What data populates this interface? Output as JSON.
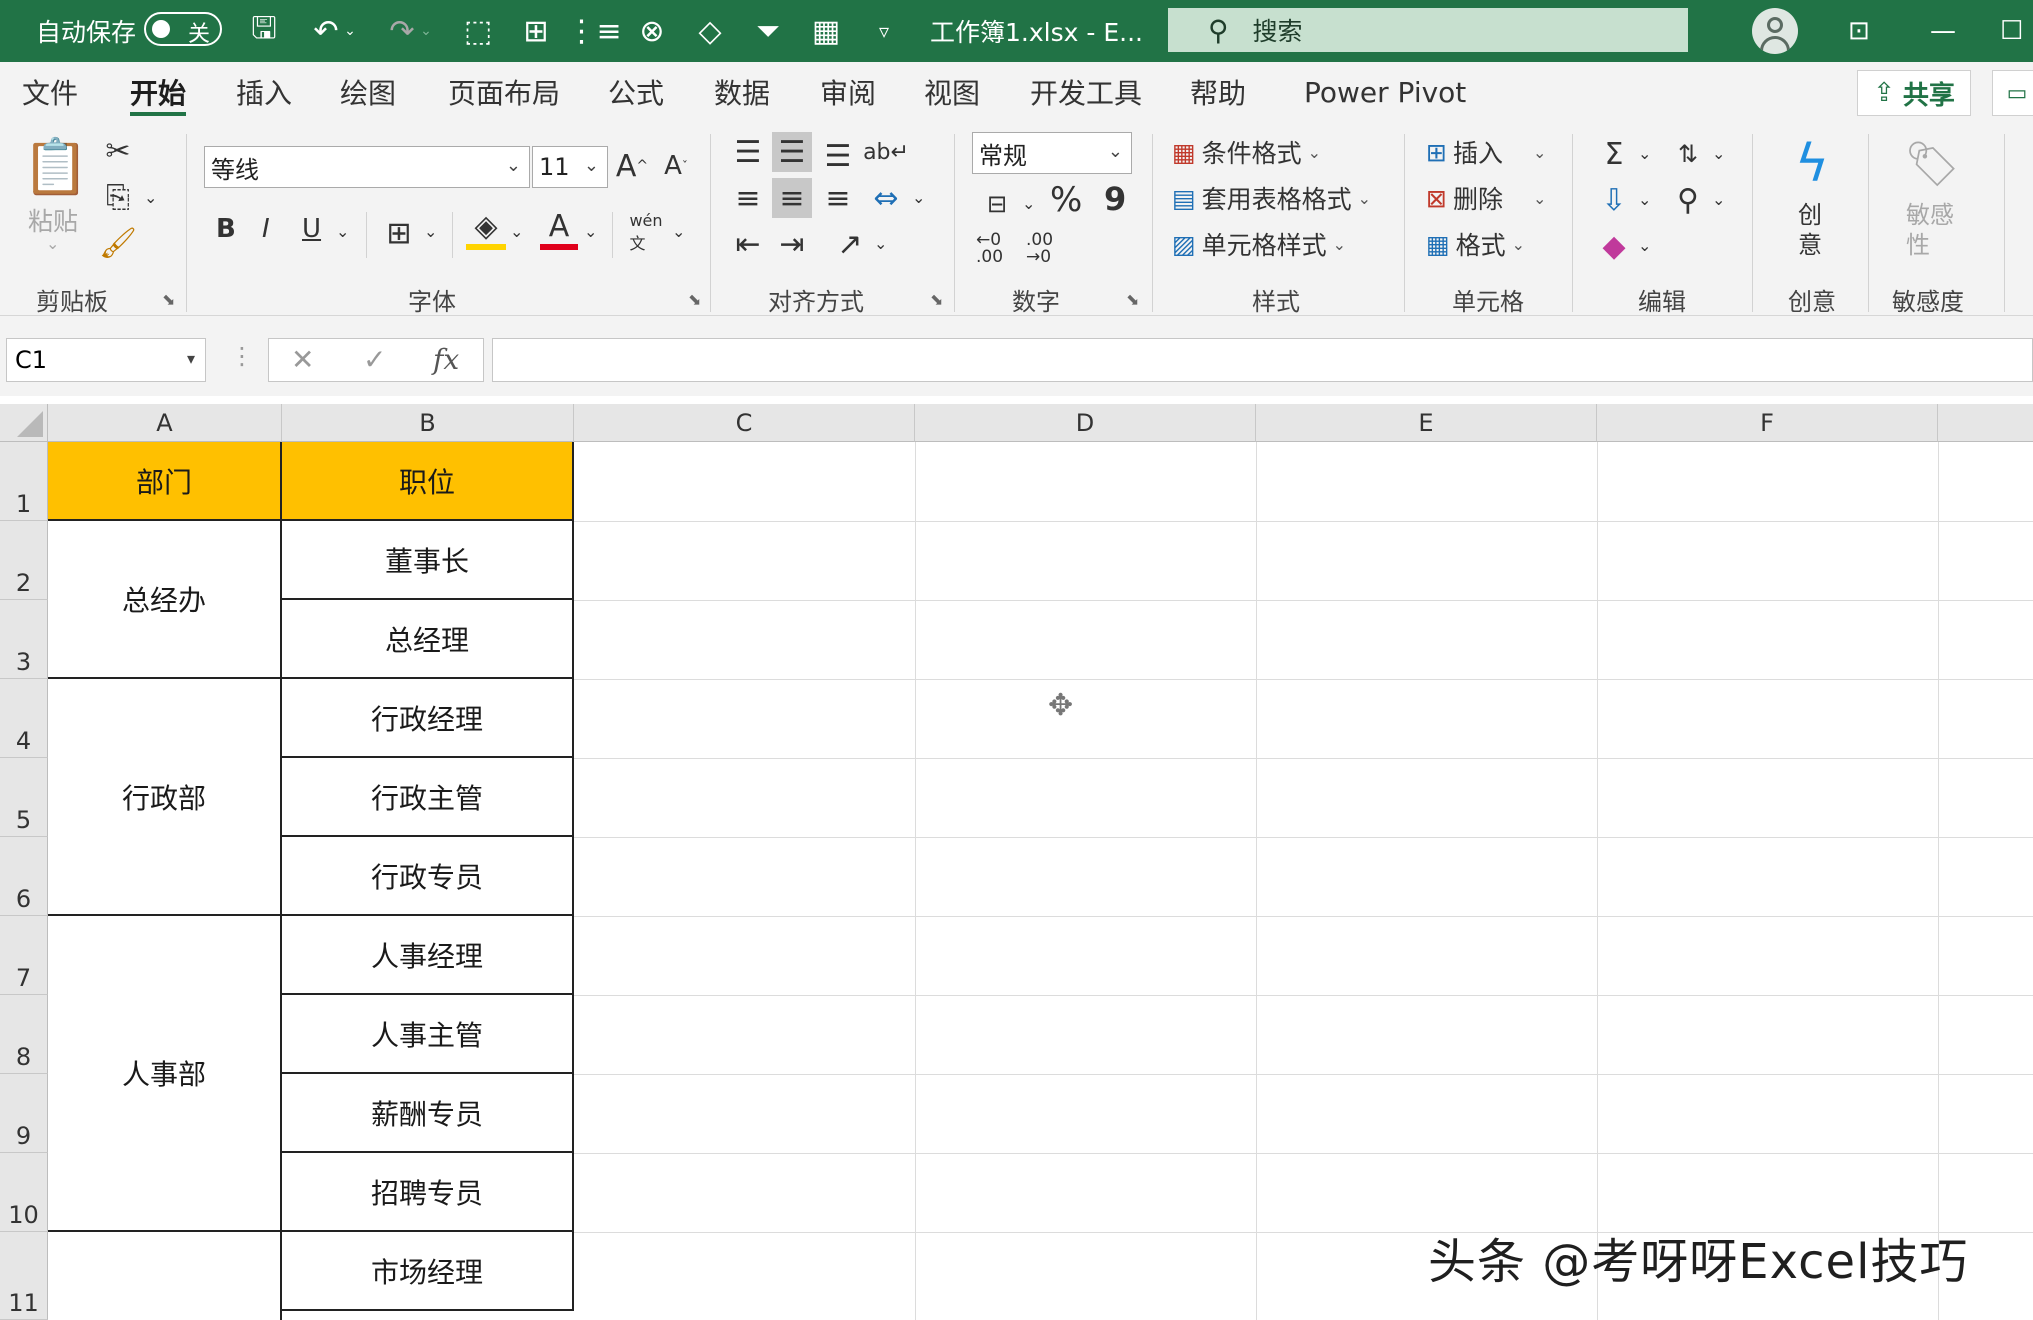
{
  "titlebar": {
    "autosave_label": "自动保存",
    "autosave_state": "关",
    "doc_title": "工作簿1.xlsx - E...",
    "search_placeholder": "搜索"
  },
  "tabs": [
    "文件",
    "开始",
    "插入",
    "绘图",
    "页面布局",
    "公式",
    "数据",
    "审阅",
    "视图",
    "开发工具",
    "帮助",
    "Power Pivot"
  ],
  "active_tab": "开始",
  "share_label": "共享",
  "ribbon": {
    "clipboard": {
      "paste": "粘贴",
      "label": "剪贴板"
    },
    "font": {
      "name": "等线",
      "size": "11",
      "bold": "B",
      "italic": "I",
      "underline": "U",
      "label": "字体"
    },
    "alignment": {
      "label": "对齐方式"
    },
    "number": {
      "format": "常规",
      "percent": "%",
      "comma": "9",
      "inc_dec": "←0 .00",
      "dec_dec": ".00 →0",
      "label": "数字"
    },
    "styles": {
      "cond": "条件格式",
      "table": "套用表格格式",
      "cell": "单元格样式",
      "label": "样式"
    },
    "cells": {
      "insert": "插入",
      "delete": "删除",
      "format": "格式",
      "label": "单元格"
    },
    "editing": {
      "label": "编辑"
    },
    "ideas": {
      "btn": "创意",
      "label": "创意"
    },
    "sensitivity": {
      "btn": "敏感性",
      "label": "敏感度"
    }
  },
  "formula_bar": {
    "name_box": "C1",
    "fx": "fx",
    "value": ""
  },
  "columns": [
    "A",
    "B",
    "C",
    "D",
    "E",
    "F"
  ],
  "rows": [
    "1",
    "2",
    "3",
    "4",
    "5",
    "6",
    "7",
    "8",
    "9",
    "10",
    "11"
  ],
  "sheet": {
    "header": {
      "dept": "部门",
      "position": "职位"
    },
    "departments": [
      "总经办",
      "行政部",
      "人事部"
    ],
    "positions": [
      "董事长",
      "总经理",
      "行政经理",
      "行政主管",
      "行政专员",
      "人事经理",
      "人事主管",
      "薪酬专员",
      "招聘专员",
      "市场经理"
    ]
  },
  "watermark": "头条 @考呀呀Excel技巧"
}
